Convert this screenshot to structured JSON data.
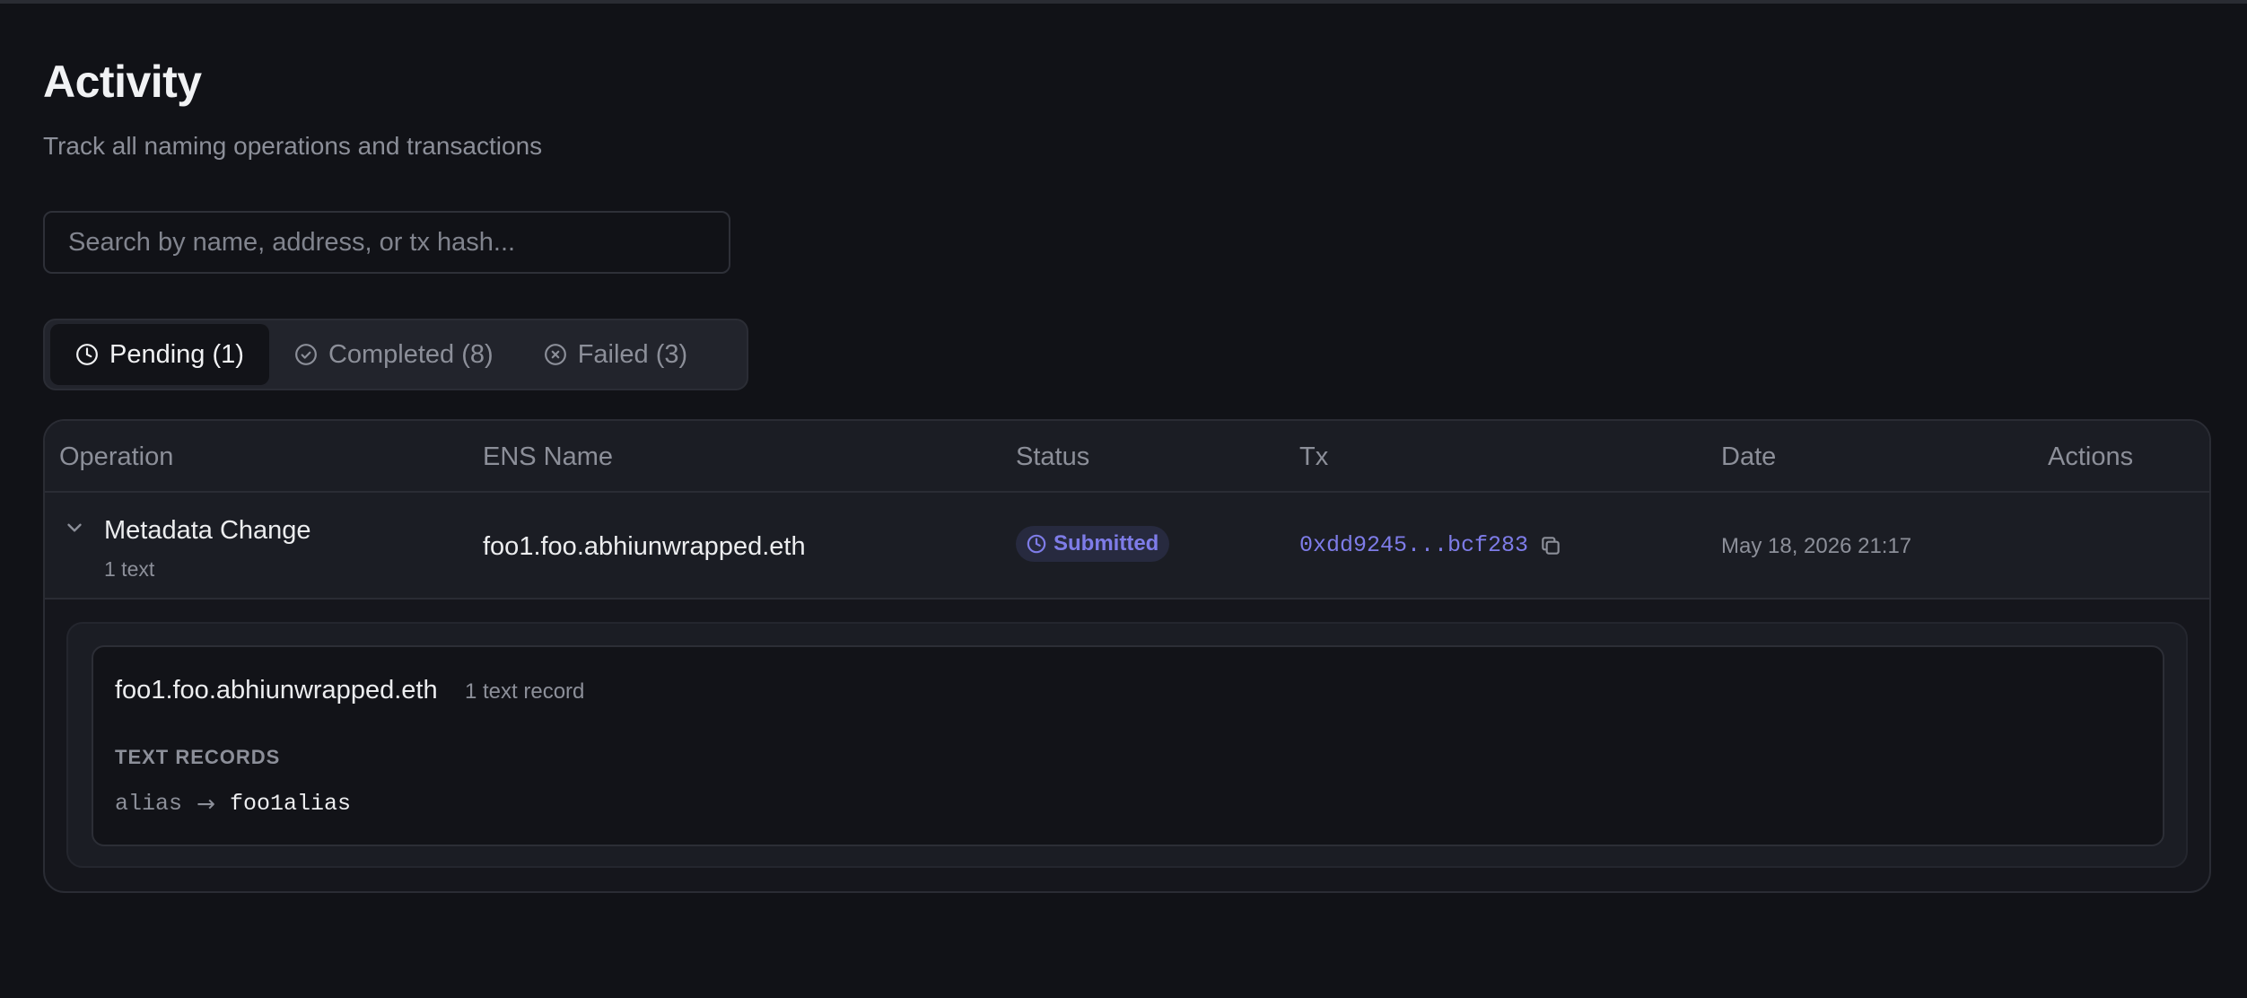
{
  "header": {
    "title": "Activity",
    "subtitle": "Track all naming operations and transactions"
  },
  "search": {
    "placeholder": "Search by name, address, or tx hash..."
  },
  "tabs": [
    {
      "label": "Pending (1)",
      "icon": "clock-icon",
      "active": true
    },
    {
      "label": "Completed (8)",
      "icon": "check-circle-icon",
      "active": false
    },
    {
      "label": "Failed (3)",
      "icon": "x-circle-icon",
      "active": false
    }
  ],
  "table": {
    "columns": [
      "Operation",
      "ENS Name",
      "Status",
      "Tx",
      "Date",
      "Actions"
    ],
    "rows": [
      {
        "operation": "Metadata Change",
        "operation_sub": "1 text",
        "ens_name": "foo1.foo.abhiunwrapped.eth",
        "status": "Submitted",
        "tx": "0xdd9245...bcf283",
        "date": "May 18, 2026 21:17"
      }
    ]
  },
  "detail": {
    "name": "foo1.foo.abhiunwrapped.eth",
    "count": "1 text record",
    "section_label": "TEXT RECORDS",
    "records": [
      {
        "key": "alias",
        "arrow": "→",
        "value": "foo1alias"
      }
    ]
  },
  "colors": {
    "background": "#111217",
    "accent": "#7E7CE8",
    "muted_text": "#8C8F99"
  }
}
